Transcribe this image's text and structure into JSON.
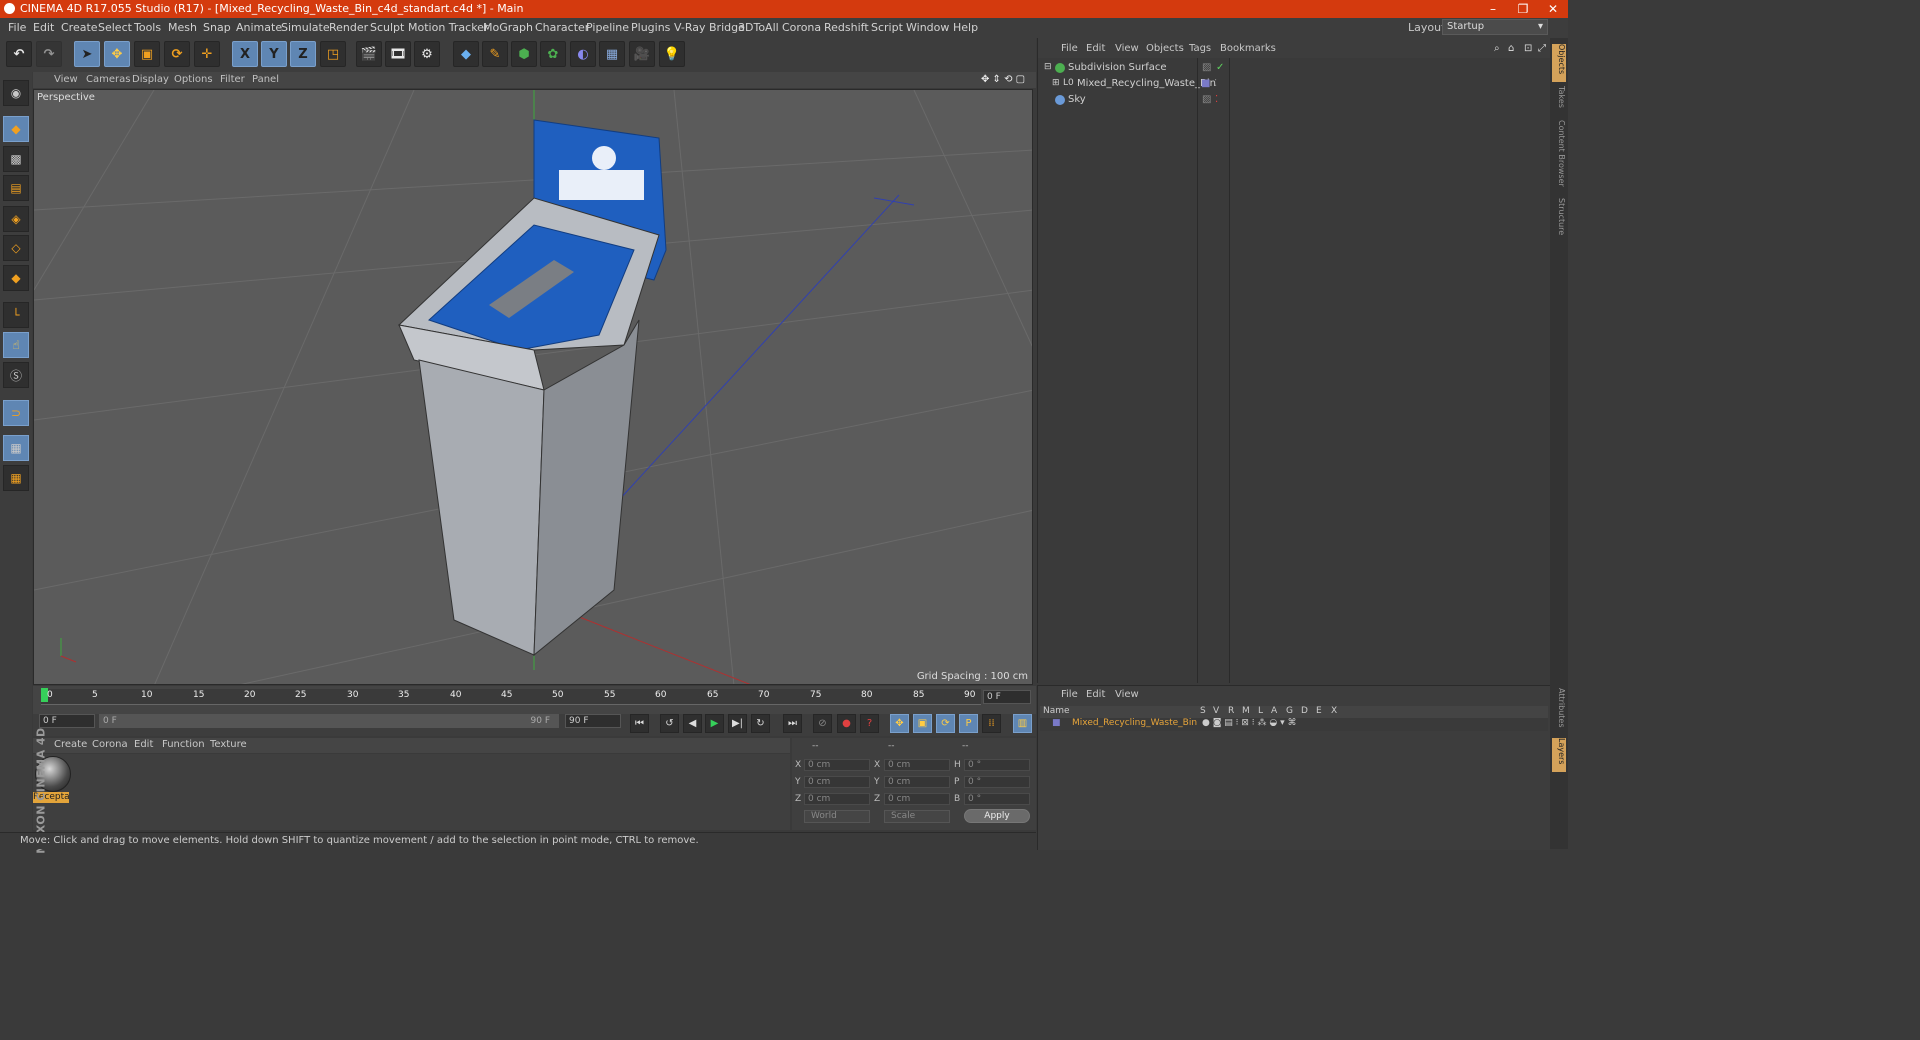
{
  "window": {
    "title": "CINEMA 4D R17.055 Studio (R17) - [Mixed_Recycling_Waste_Bin_c4d_standart.c4d *] - Main",
    "minimize": "–",
    "restore": "❐",
    "close": "✕",
    "titlebar_color": "#d43a0e"
  },
  "menubar": {
    "items": [
      "File",
      "Edit",
      "Create",
      "Select",
      "Tools",
      "Mesh",
      "Snap",
      "Animate",
      "Simulate",
      "Render",
      "Sculpt",
      "Motion Tracker",
      "MoGraph",
      "Character",
      "Pipeline",
      "Plugins",
      "V-Ray Bridge",
      "3DToAll",
      "Corona",
      "Redshift",
      "Script",
      "Window",
      "Help"
    ],
    "layout_label": "Layout:",
    "layout_value": "Startup"
  },
  "toolbar": {
    "axis_x": "X",
    "axis_y": "Y",
    "axis_z": "Z",
    "icons": [
      "undo-icon",
      "redo-icon",
      "select-icon",
      "move-icon",
      "scale-icon",
      "rotate-icon",
      "move-icon-2",
      "x-axis-icon",
      "y-axis-icon",
      "z-axis-icon",
      "coord-system-icon",
      "render-view-icon",
      "render-picture-viewer-icon",
      "render-settings-icon",
      "cube-icon",
      "pen-icon",
      "subdivision-icon",
      "array-icon",
      "deformer-icon",
      "floor-icon",
      "camera-icon",
      "light-icon"
    ]
  },
  "viewport": {
    "menu": [
      "View",
      "Cameras",
      "Display",
      "Options",
      "Filter",
      "Panel"
    ],
    "label": "Perspective",
    "grid_spacing": "Grid Spacing : 100 cm"
  },
  "timeline": {
    "ticks": [
      "0",
      "5",
      "10",
      "15",
      "20",
      "25",
      "30",
      "35",
      "40",
      "45",
      "50",
      "55",
      "60",
      "65",
      "70",
      "75",
      "80",
      "85",
      "90"
    ],
    "current_frame": "0 F",
    "start_field": "0 F",
    "range_start": "0 F",
    "range_end": "90 F",
    "end_field": "90 F"
  },
  "materials": {
    "menu": [
      "Create",
      "Corona",
      "Edit",
      "Function",
      "Texture"
    ],
    "items": [
      {
        "label": "Recepta"
      }
    ]
  },
  "coordinates": {
    "header": [
      "--",
      "--",
      "--"
    ],
    "rows": [
      {
        "l1": "X",
        "v1": "0 cm",
        "l2": "X",
        "v2": "0 cm",
        "l3": "H",
        "v3": "0 °"
      },
      {
        "l1": "Y",
        "v1": "0 cm",
        "l2": "Y",
        "v2": "0 cm",
        "l3": "P",
        "v3": "0 °"
      },
      {
        "l1": "Z",
        "v1": "0 cm",
        "l2": "Z",
        "v2": "0 cm",
        "l3": "B",
        "v3": "0 °"
      }
    ],
    "mode_world": "World",
    "mode_scale": "Scale",
    "apply": "Apply"
  },
  "status": {
    "text": "Move: Click and drag to move elements. Hold down SHIFT to quantize movement / add to the selection in point mode, CTRL to remove."
  },
  "logo": {
    "text": "MAXON CINEMA 4D"
  },
  "object_manager": {
    "menu": [
      "File",
      "Edit",
      "View",
      "Objects",
      "Tags",
      "Bookmarks"
    ],
    "objects": [
      {
        "name": "Subdivision Surface",
        "color": "#4caf50"
      },
      {
        "name": "Mixed_Recycling_Waste_Bin",
        "color": "#7a7ac8"
      },
      {
        "name": "Sky",
        "color": "#6a9ad8"
      }
    ]
  },
  "layers": {
    "menu": [
      "File",
      "Edit",
      "View"
    ],
    "columns": [
      "Name",
      "S",
      "V",
      "R",
      "M",
      "L",
      "A",
      "G",
      "D",
      "E",
      "X"
    ],
    "row_name": "Mixed_Recycling_Waste_Bin"
  },
  "right_tabs": [
    "Objects",
    "Takes",
    "Content Browser",
    "Structure",
    "Attributes",
    "Layers"
  ],
  "colors": {
    "accent_blue": "#5f86b3",
    "bin_blue": "#1f5fbf",
    "layer_orange": "#e6a43a"
  }
}
